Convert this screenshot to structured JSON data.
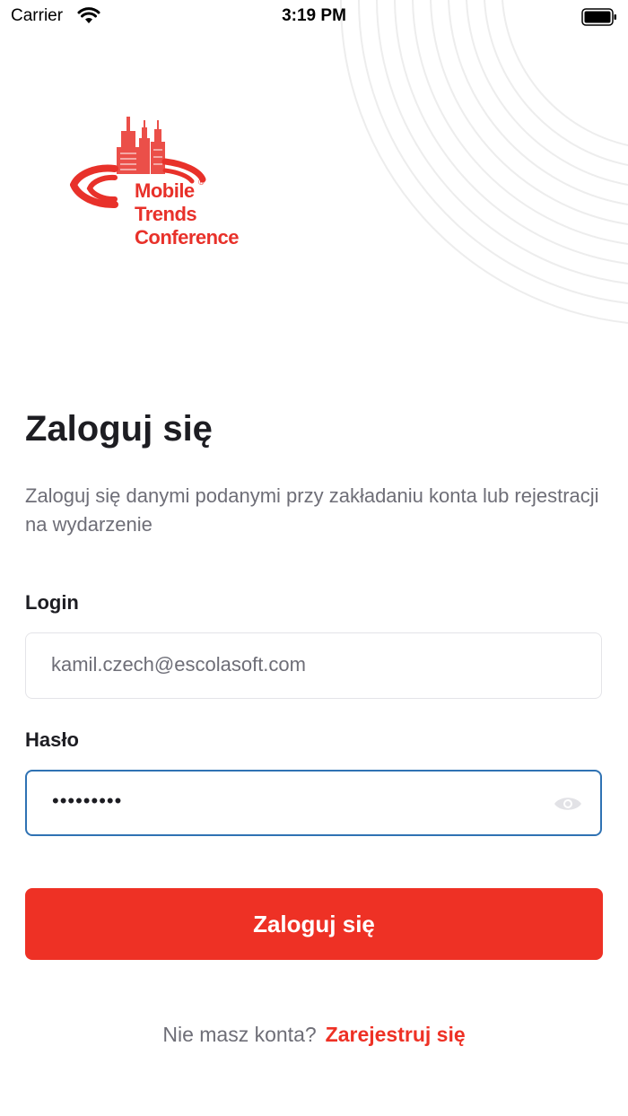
{
  "status_bar": {
    "carrier": "Carrier",
    "time": "3:19 PM"
  },
  "logo": {
    "line1": "Mobile",
    "line2": "Trends",
    "line3": "Conference",
    "registered": "®"
  },
  "page": {
    "title": "Zaloguj się",
    "subtitle": "Zaloguj się danymi podanymi przy zakładaniu konta lub rejestracji na wydarzenie"
  },
  "form": {
    "login_label": "Login",
    "login_value": "kamil.czech@escolasoft.com",
    "password_label": "Hasło",
    "password_value": "•••••••••",
    "submit_label": "Zaloguj się"
  },
  "footer": {
    "question": "Nie masz konta?",
    "register_link": "Zarejestruj się"
  },
  "colors": {
    "accent": "#ee3125",
    "focus_border": "#2f72b3",
    "text_dark": "#1d1d22",
    "text_muted": "#6e6e77"
  },
  "icons": {
    "wifi": "wifi-icon",
    "battery": "battery-icon",
    "eye": "eye-icon"
  }
}
